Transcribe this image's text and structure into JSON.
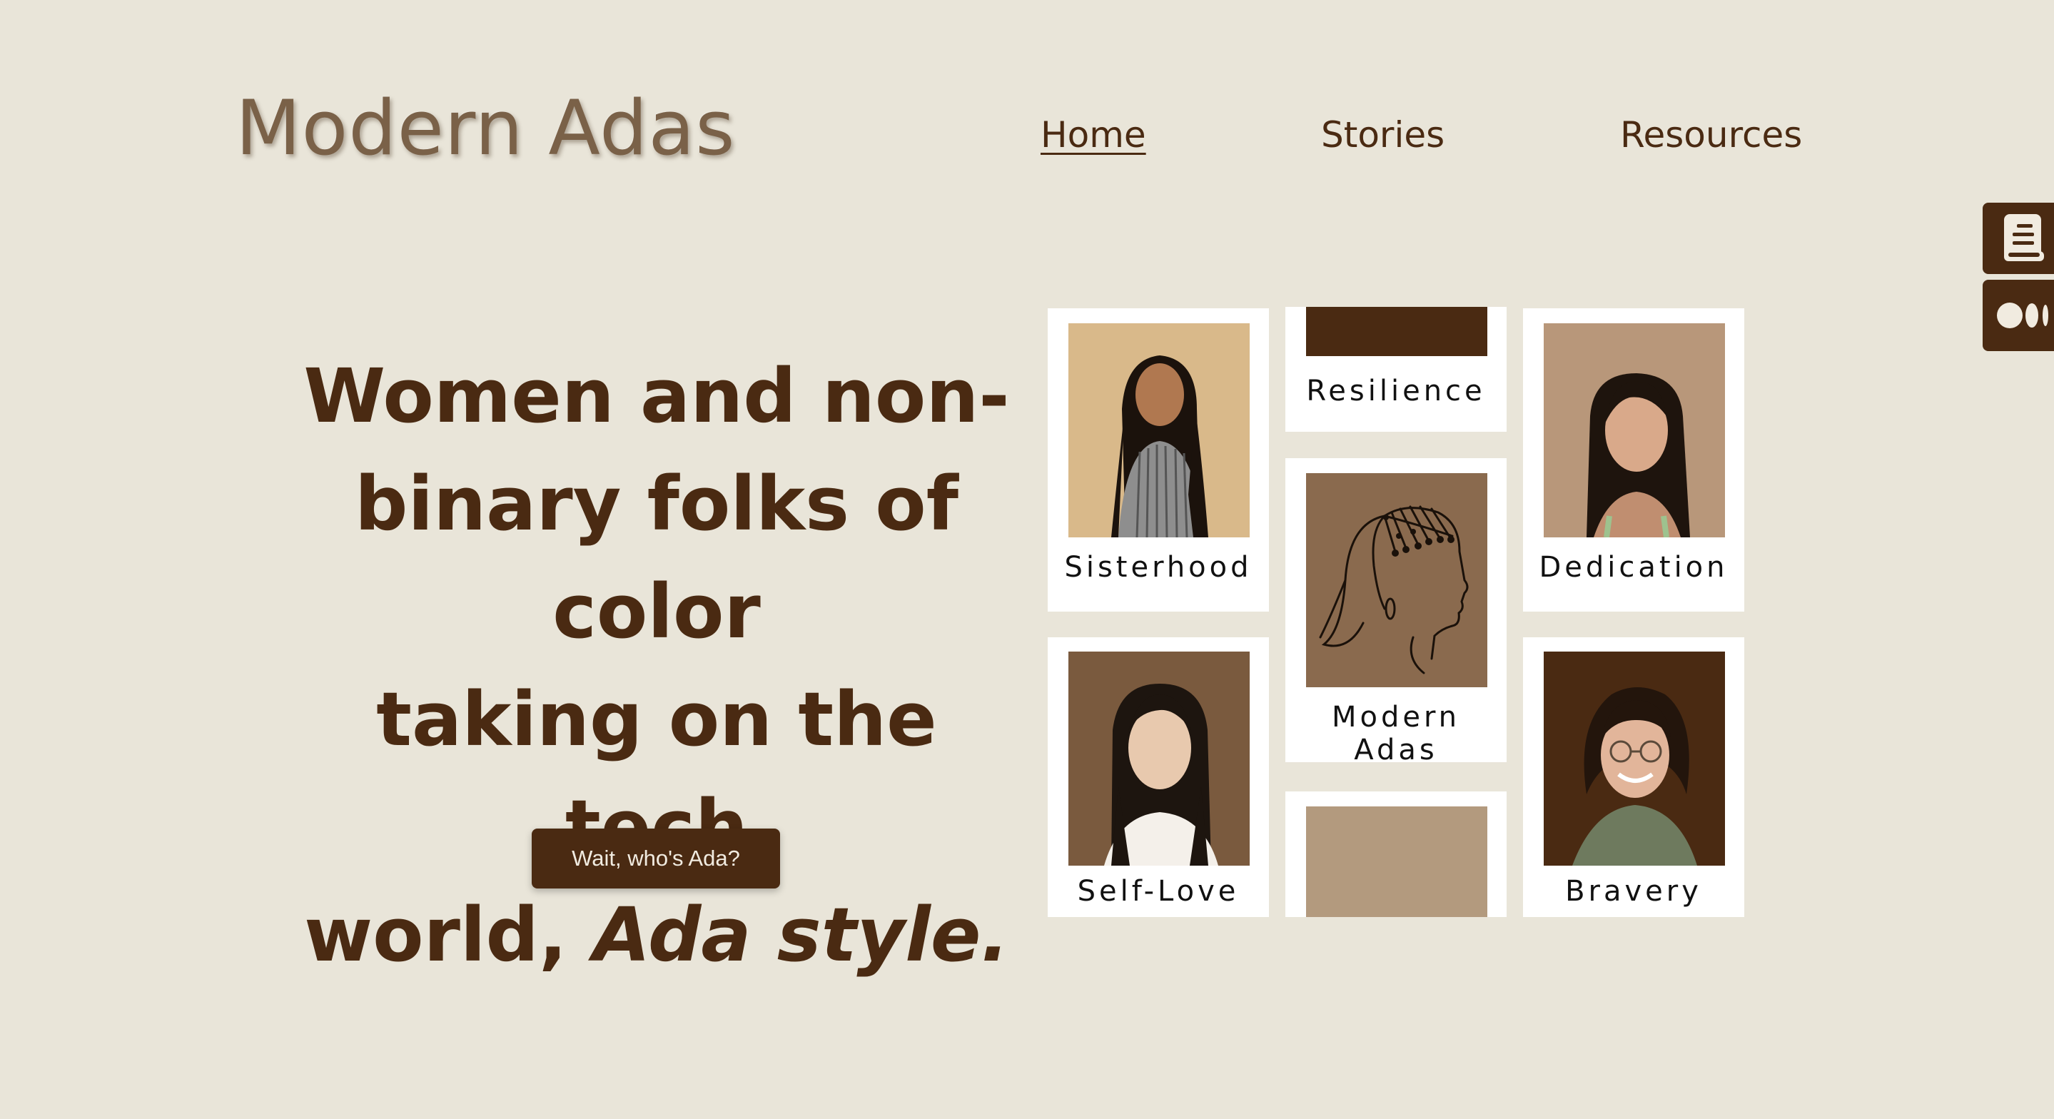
{
  "header": {
    "logo": "Modern Adas",
    "nav": [
      {
        "label": "Home",
        "active": true
      },
      {
        "label": "Stories",
        "active": false
      },
      {
        "label": "Resources",
        "active": false
      }
    ]
  },
  "side_tabs": [
    {
      "icon": "book-icon"
    },
    {
      "icon": "medium-icon"
    }
  ],
  "hero": {
    "line1": "Women and non-",
    "line2": "binary folks of color",
    "line3": "taking on the tech",
    "line4_plain": "world, ",
    "line4_italic": "Ada style.",
    "cta_label": "Wait, who's Ada?"
  },
  "cards": [
    {
      "label": "Sisterhood",
      "photo_bg": "#d9b98a"
    },
    {
      "label": "Resilience",
      "photo_bg": "#4a2a12"
    },
    {
      "label": "Dedication",
      "photo_bg": "#b8977a"
    },
    {
      "label": "Modern Adas",
      "photo_bg": "#8a6a4e"
    },
    {
      "label": "Self-Love",
      "photo_bg": "#7a5a3e"
    },
    {
      "label": "Bravery",
      "photo_bg": "#4a2a12"
    },
    {
      "label": "",
      "photo_bg": "#b39a7e"
    }
  ],
  "colors": {
    "background": "#e9e5d9",
    "brand_brown": "#4a2a12",
    "card": "#ffffff"
  }
}
